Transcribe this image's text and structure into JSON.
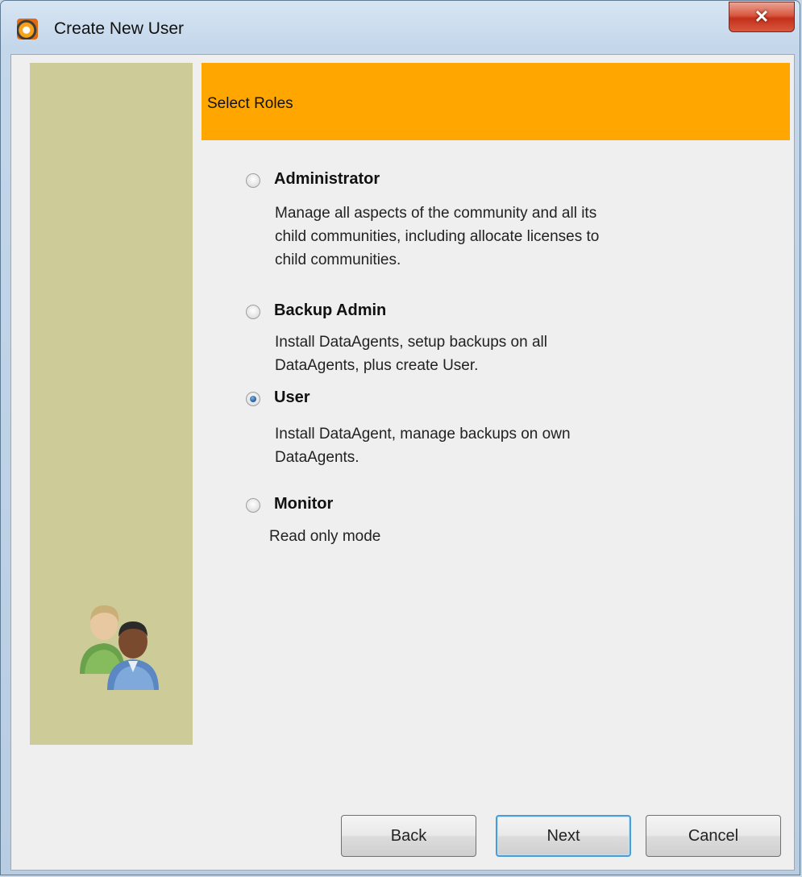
{
  "window": {
    "title": "Create New User",
    "close_glyph": "✕"
  },
  "header": {
    "title": "Select Roles",
    "background_color": "#ffa700"
  },
  "side_panel": {
    "background_color": "#cdcc99",
    "icon": "users-icon"
  },
  "roles": [
    {
      "name": "Administrator",
      "selected": false,
      "description_lines": [
        "Manage all aspects of the community and all its",
        "child communities, including allocate licenses to",
        "child communities."
      ]
    },
    {
      "name": "Backup Admin",
      "selected": false,
      "description_lines": [
        "Install DataAgents, setup backups on all",
        "DataAgents, plus create User."
      ]
    },
    {
      "name": "User",
      "selected": true,
      "description_lines": [
        "Install DataAgent, manage backups on own",
        "DataAgents."
      ]
    },
    {
      "name": "Monitor",
      "selected": false,
      "description_lines": [
        "Read only mode"
      ]
    }
  ],
  "buttons": {
    "back": "Back",
    "next": "Next",
    "cancel": "Cancel"
  }
}
